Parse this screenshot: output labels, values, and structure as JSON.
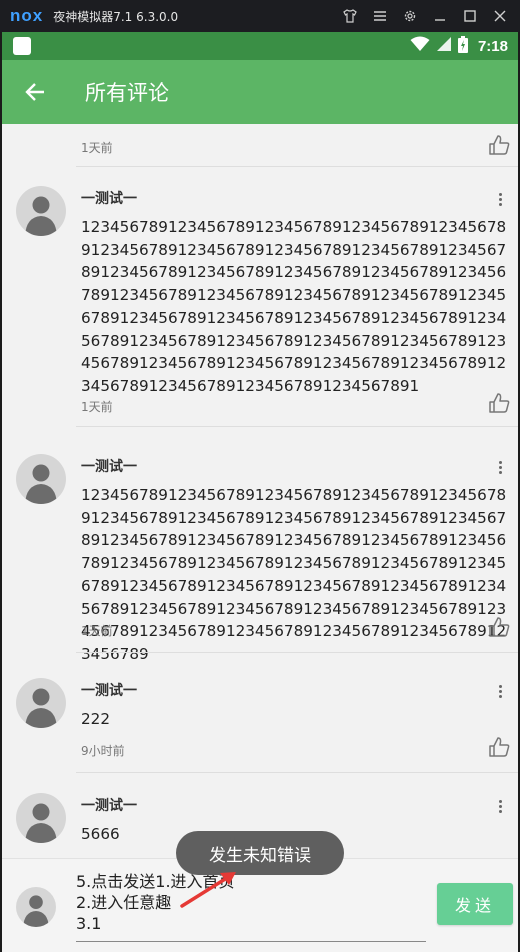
{
  "emulator": {
    "logo": "nox",
    "title": "夜神模拟器7.1  6.3.0.0",
    "icons": [
      "shirt-icon",
      "menu-icon",
      "gear-icon",
      "minimize-icon",
      "maximize-icon",
      "close-icon"
    ]
  },
  "statusbar": {
    "time": "7:18"
  },
  "toolbar": {
    "title": "所有评论"
  },
  "comments": [
    {
      "name": "",
      "content": "",
      "time": "1天前"
    },
    {
      "name": "一测试一",
      "content": "1234567891234567891234567891234567891234567891234567891234567891234567891234567891234567891234567891234567891234567891234567891234567891234567891234567891234567891234567891234567891234567891234567891234567891234567891234567891234567891234567891234567891234567891234567891234567891234567891234567891234567891234567891234567891234567891234567891",
      "time": "1天前"
    },
    {
      "name": "一测试一",
      "content": "123456789123456789123456789123456789123456789123456789123456789123456789123456789123456789123456789123456789123456789123456789123456789123456789123456789123456789123456789123456789123456789123456789123456789123456789123456789123456789123456789123456789123456789123456789123456789123456789123456789123456789123456789",
      "time": "1天前"
    },
    {
      "name": "一测试一",
      "content": "222",
      "time": "9小时前"
    },
    {
      "name": "一测试一",
      "content": "5666",
      "time": ""
    }
  ],
  "toast": {
    "message": "发生未知错误"
  },
  "input": {
    "value": "5.点击发送1.进入首页\n2.进入任意趣\n3.1",
    "send_label": "发送"
  },
  "colors": {
    "toolbar": "#5cb565",
    "statusbar": "#3a8f45",
    "send": "#66cf95",
    "annotation_arrow": "#e53935"
  }
}
